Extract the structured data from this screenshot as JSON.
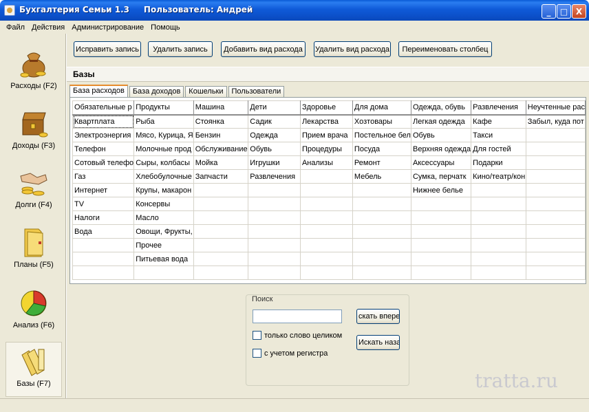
{
  "window": {
    "title": "Бухгалтерия Семьи 1.3     Пользователь: Андрей",
    "controls": [
      "_",
      "□",
      "X"
    ]
  },
  "menu": [
    "Файл",
    "Действия",
    "Администрирование",
    "Помощь"
  ],
  "nav": [
    {
      "label": "Расходы (F2)",
      "icon": "money-bag-icon",
      "active": false
    },
    {
      "label": "Доходы (F3)",
      "icon": "treasure-chest-icon",
      "active": false
    },
    {
      "label": "Долги (F4)",
      "icon": "handshake-coins-icon",
      "active": false
    },
    {
      "label": "Планы (F5)",
      "icon": "folder-icon",
      "active": false
    },
    {
      "label": "Анализ (F6)",
      "icon": "pie-chart-icon",
      "active": false
    },
    {
      "label": "Базы (F7)",
      "icon": "binders-icon",
      "active": true
    }
  ],
  "toolbar": {
    "edit": "Исправить запись",
    "delete": "Удалить запись",
    "add_type": "Добавить вид расхода",
    "delete_type": "Удалить вид расхода",
    "rename_col": "Переименовать столбец"
  },
  "section_title": "Базы",
  "tabs": [
    "База расходов",
    "База доходов",
    "Кошельки",
    "Пользователи"
  ],
  "grid": {
    "headers": [
      "Обязательные р",
      "Продукты",
      "Машина",
      "Дети",
      "Здоровье",
      "Для дома",
      "Одежда, обувь",
      "Развлечения",
      "Неучтенные рас"
    ],
    "rows": [
      [
        "Квартплата",
        "Рыба",
        "Стоянка",
        "Садик",
        "Лекарства",
        "Хозтовары",
        "Легкая одежда",
        "Кафе",
        "Забыл, куда пот"
      ],
      [
        "Электроэнергия",
        "Мясо, Курица, Я",
        "Бензин",
        "Одежда",
        "Прием врача",
        "Постельное бел",
        "Обувь",
        "Такси",
        ""
      ],
      [
        "Телефон",
        "Молочные прод",
        "Обслуживание",
        "Обувь",
        "Процедуры",
        "Посуда",
        "Верхняя одежда",
        "Для гостей",
        ""
      ],
      [
        "Сотовый телефо",
        "Сыры, колбасы",
        "Мойка",
        "Игрушки",
        "Анализы",
        "Ремонт",
        "Аксессуары",
        "Подарки",
        ""
      ],
      [
        "Газ",
        "Хлебобулочные",
        "Запчасти",
        "Развлечения",
        "",
        "Мебель",
        "Сумка, перчатк",
        "Кино/театр/кон",
        ""
      ],
      [
        "Интернет",
        "Крупы, макарон",
        "",
        "",
        "",
        "",
        "Нижнее белье",
        "",
        ""
      ],
      [
        "TV",
        "Консервы",
        "",
        "",
        "",
        "",
        "",
        "",
        ""
      ],
      [
        "Налоги",
        "Масло",
        "",
        "",
        "",
        "",
        "",
        "",
        ""
      ],
      [
        "Вода",
        "Овощи, Фрукты,",
        "",
        "",
        "",
        "",
        "",
        "",
        ""
      ],
      [
        "",
        "Прочее",
        "",
        "",
        "",
        "",
        "",
        "",
        ""
      ],
      [
        "",
        "Питьевая вода",
        "",
        "",
        "",
        "",
        "",
        "",
        ""
      ],
      [
        "",
        "",
        "",
        "",
        "",
        "",
        "",
        "",
        ""
      ]
    ]
  },
  "search": {
    "label": "Поиск",
    "value": "",
    "find_next": "скать впере",
    "find_prev": "Искать назад",
    "whole_word": "только слово целиком",
    "match_case": "с учетом регистра"
  },
  "watermark": "tratta.ru"
}
